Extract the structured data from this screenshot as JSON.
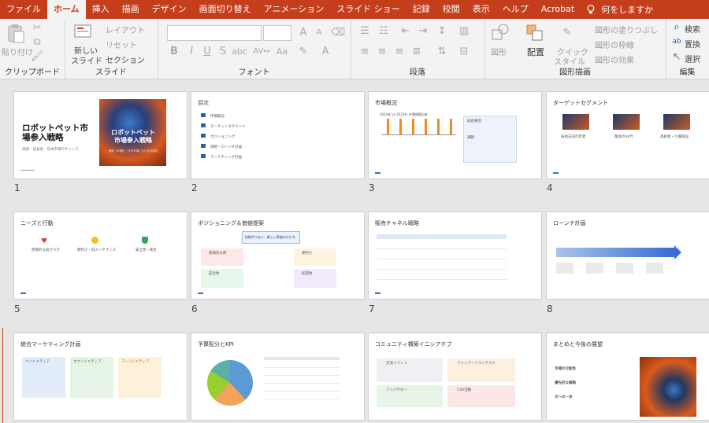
{
  "tabs": [
    "ファイル",
    "ホーム",
    "挿入",
    "描画",
    "デザイン",
    "画面切り替え",
    "アニメーション",
    "スライド ショー",
    "記録",
    "校閲",
    "表示",
    "ヘルプ",
    "Acrobat"
  ],
  "active_tab": "ホーム",
  "tell_me": "何をしますか",
  "ribbon": {
    "clipboard": {
      "paste": "貼り付け",
      "label": "クリップボード"
    },
    "slides": {
      "new_slide": "新しい",
      "new_slide2": "スライド",
      "layout": "レイアウト",
      "reset": "リセット",
      "section": "セクション",
      "label": "スライド"
    },
    "font": {
      "label": "フォント",
      "bold": "B",
      "italic": "I",
      "underline": "U",
      "strike": "S",
      "grow": "A",
      "shrink": "A",
      "case": "Aa"
    },
    "paragraph": {
      "label": "段落"
    },
    "drawing": {
      "shapes": "図形",
      "arrange": "配置",
      "quick": "クイック",
      "quick2": "スタイル",
      "fill": "図形の塗りつぶし",
      "outline": "図形の枠線",
      "effect": "図形の効果",
      "label": "図形描画"
    },
    "editing": {
      "find": "検索",
      "replace": "置換",
      "select": "選択",
      "label": "編集"
    }
  },
  "slides": [
    {
      "n": "1",
      "title": "ロボットペット市場参入戦略",
      "subtitle": "価値・成長性・日本市場のチャンス",
      "img_title": "ロボットペット\n市場参入戦略",
      "img_sub": "価値・市場性・日本市場における可能性"
    },
    {
      "n": "2",
      "title": "目次",
      "items": [
        "市場概況",
        "ターゲットセグメント",
        "ポジショニング",
        "価格・ローンチ計画",
        "マーケティング計画"
      ]
    },
    {
      "n": "3",
      "title": "市場概況",
      "chart_title": "2024年 vs 2033年 市場規模比較",
      "side_title": "成長要因",
      "side_title2": "課題"
    },
    {
      "n": "4",
      "title": "ターゲットセグメント",
      "cols": [
        "技術志向の若者",
        "都会の30代",
        "高齢者・介護施設"
      ]
    },
    {
      "n": "5",
      "title": "ニーズと行動",
      "items": [
        "感情的な結びつき",
        "便利さ・低メンテナンス",
        "安全性・衛生"
      ]
    },
    {
      "n": "6",
      "title": "ポジショニング＆価値提案",
      "center": "技術がつなぐ、新しい家族のかたち",
      "cards": [
        "感情的な絆",
        "便利さ",
        "安全性",
        "拡張性"
      ]
    },
    {
      "n": "7",
      "title": "販売チャネル戦略"
    },
    {
      "n": "8",
      "title": "ローンチ計画"
    },
    {
      "n": "9",
      "title": "統合マーケティング計画",
      "cols": [
        "ペイドメディア",
        "オウンドメディア",
        "アーンドメディア"
      ]
    },
    {
      "n": "10",
      "title": "予算配分とKPI"
    },
    {
      "n": "11",
      "title": "コミュニティ構築イニシアチブ",
      "cards": [
        "交流イベント",
        "ファンアートコンテスト",
        "アンバサダー",
        "CSR活動"
      ]
    },
    {
      "n": "12",
      "title": "まとめと今後の展望",
      "items": [
        "市場の可能性",
        "優先的な戦略",
        "次への一歩"
      ]
    }
  ],
  "colors": {
    "accent": "#c43e1c",
    "ribbon": "#f3f3f3",
    "workspace": "#e6e6e6",
    "link": "#3a6bd6"
  }
}
